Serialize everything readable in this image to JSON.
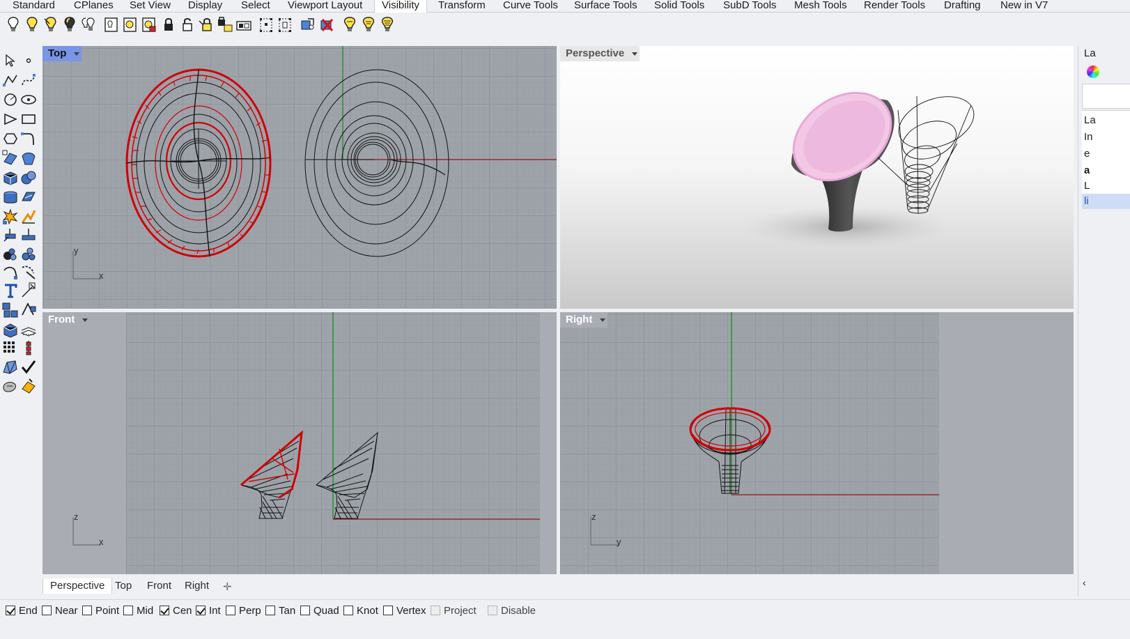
{
  "tabs": [
    {
      "label": "Standard",
      "active": false
    },
    {
      "label": "CPlanes",
      "active": false
    },
    {
      "label": "Set View",
      "active": false
    },
    {
      "label": "Display",
      "active": false
    },
    {
      "label": "Select",
      "active": false
    },
    {
      "label": "Viewport Layout",
      "active": false
    },
    {
      "label": "Visibility",
      "active": true
    },
    {
      "label": "Transform",
      "active": false
    },
    {
      "label": "Curve Tools",
      "active": false
    },
    {
      "label": "Surface Tools",
      "active": false
    },
    {
      "label": "Solid Tools",
      "active": false
    },
    {
      "label": "SubD Tools",
      "active": false
    },
    {
      "label": "Mesh Tools",
      "active": false
    },
    {
      "label": "Render Tools",
      "active": false
    },
    {
      "label": "Drafting",
      "active": false
    },
    {
      "label": "New in V7",
      "active": false
    }
  ],
  "toolbar_icons": [
    "bulb-icon",
    "bulb-on-icon",
    "bulb-selected-icon",
    "bulb-swap-icon",
    "bulb-all-icon",
    "show-object-icon",
    "show-selected-icon",
    "hide-swap-icon",
    "lock-icon",
    "unlock-icon",
    "lock-selected-icon",
    "lock-swap-icon",
    "unlock-selected-icon",
    "points-on-icon",
    "points-off-icon",
    "isolate-icon",
    "hide-x-icon",
    "bulb-light-icon",
    "bulb-light-2-icon",
    "bulb-light-3-icon"
  ],
  "left_tools": [
    "select-arrow-icon",
    "point-icon",
    "polyline-icon",
    "curve-icon",
    "circle-icon",
    "ellipse-icon",
    "polygon-icon",
    "rectangle-icon",
    "arc-icon",
    "fillet-icon",
    "surface-from-curves-icon",
    "loft-icon",
    "box-icon",
    "sphere-icon",
    "extrude-icon",
    "planar-surface-icon",
    "explode-icon",
    "boolean-icon",
    "move-icon",
    "copy-icon",
    "mesh-icon",
    "mesh-patch-icon",
    "rotate-icon",
    "scale-icon",
    "text-icon",
    "dimension-icon",
    "group-icon",
    "block-icon",
    "render-object-icon",
    "layer-icon",
    "array-icon",
    "gumball-icon",
    "analyze-icon",
    "check-icon",
    "solid-edit-icon",
    "paint-icon"
  ],
  "viewports": {
    "top": {
      "title": "Top",
      "axis_h": "x",
      "axis_v": "y"
    },
    "perspective": {
      "title": "Perspective"
    },
    "front": {
      "title": "Front",
      "axis_h": "x",
      "axis_v": "z"
    },
    "right": {
      "title": "Right",
      "axis_h": "y",
      "axis_v": "z"
    }
  },
  "viewport_tabs": [
    {
      "label": "Perspective",
      "active": true
    },
    {
      "label": "Top",
      "active": false
    },
    {
      "label": "Front",
      "active": false
    },
    {
      "label": "Right",
      "active": false
    }
  ],
  "osnaps": [
    {
      "label": "End",
      "checked": true,
      "disabled": false
    },
    {
      "label": "Near",
      "checked": false,
      "disabled": false
    },
    {
      "label": "Point",
      "checked": false,
      "disabled": false
    },
    {
      "label": "Mid",
      "checked": false,
      "disabled": false
    },
    {
      "label": "Cen",
      "checked": true,
      "disabled": false
    },
    {
      "label": "Int",
      "checked": true,
      "disabled": false
    },
    {
      "label": "Perp",
      "checked": false,
      "disabled": false
    },
    {
      "label": "Tan",
      "checked": false,
      "disabled": false
    },
    {
      "label": "Quad",
      "checked": false,
      "disabled": false
    },
    {
      "label": "Knot",
      "checked": false,
      "disabled": false
    },
    {
      "label": "Vertex",
      "checked": false,
      "disabled": false
    },
    {
      "label": "Project",
      "checked": false,
      "disabled": true
    },
    {
      "label": "Disable",
      "checked": false,
      "disabled": true
    }
  ],
  "right_panel": {
    "header": "La",
    "rows": [
      "La",
      "In",
      "e",
      "a",
      "L",
      "li"
    ]
  },
  "colors": {
    "grid_bg": "#9ea3aa",
    "grid_minor": "#959aa1",
    "grid_major": "#848990",
    "selected_curve": "#d10000",
    "wire": "#111111",
    "x_axis": "#9a1010",
    "y_axis": "#0f8a0f",
    "funnel_pink": "#f1c6e6"
  }
}
